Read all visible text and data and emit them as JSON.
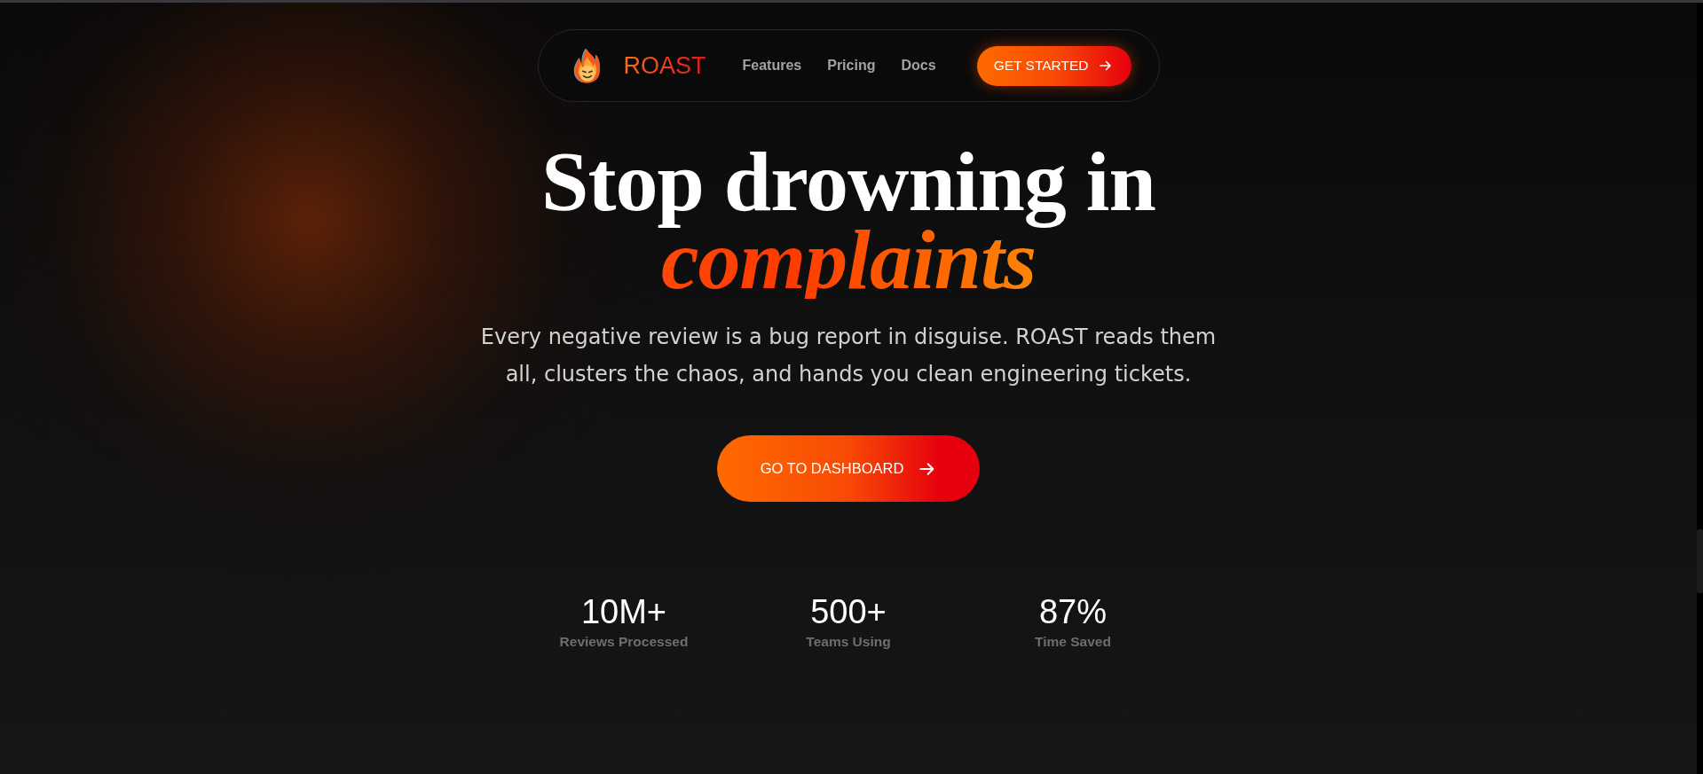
{
  "nav": {
    "logo_text": "ROAST",
    "links": [
      {
        "label": "Features"
      },
      {
        "label": "Pricing"
      },
      {
        "label": "Docs"
      }
    ],
    "cta": "GET STARTED"
  },
  "hero": {
    "title": "Stop drowning in *complaints*",
    "subtitle": "Every negative review is a bug report in disguise. ROAST reads them all, clusters the chaos, and hands you clean engineering tickets.",
    "button": "GO TO DASHBOARD"
  },
  "stats": [
    {
      "value": "10M+",
      "label": "Reviews Processed"
    },
    {
      "value": "500+",
      "label": "Teams Using"
    },
    {
      "value": "87%",
      "label": "Time Saved"
    }
  ]
}
